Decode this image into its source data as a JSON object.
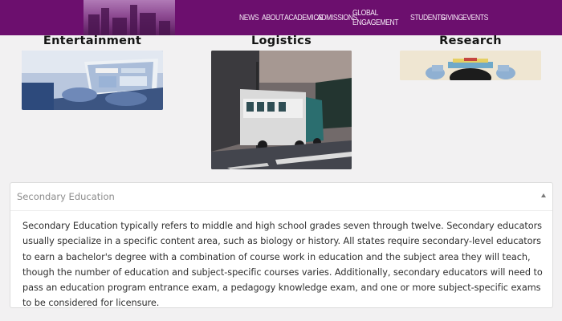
{
  "nav": {
    "items": [
      "NEWS",
      "ABOUT",
      "ACADEMICS",
      "ADMISSIONS",
      "GLOBAL ENGAGEMENT",
      "STUDENTS",
      "GIVING",
      "EVENTS"
    ]
  },
  "cards": [
    {
      "title": "Entertainment",
      "image": "person-using-laptop-photo"
    },
    {
      "title": "Logistics",
      "image": "delivery-truck-photo"
    },
    {
      "title": "Research",
      "image": "person-reading-book-photo"
    }
  ],
  "accordion": {
    "title": "Secondary Education",
    "expanded": true,
    "body": "Secondary Education typically refers to middle and high school grades seven through twelve. Secondary educators usually specialize in a specific content area, such as biology or history. All states require secondary-level educators to earn a bachelor's degree with a combination of course work in education and the subject area they will teach, though the number of education and subject-specific courses varies. Additionally, secondary educators will need to pass an education program entrance exam, a pedagogy knowledge exam, and one or more subject-specific exams to be considered for licensure."
  },
  "colors": {
    "header": "#6c0f6e",
    "background": "#f2f1f2"
  }
}
